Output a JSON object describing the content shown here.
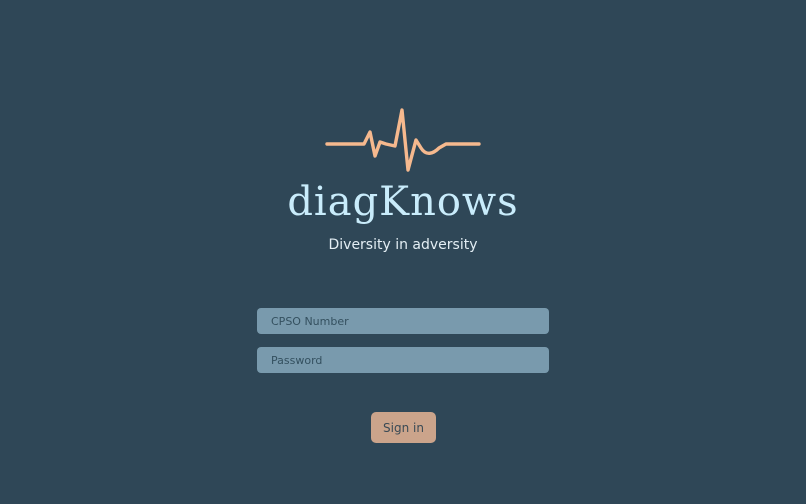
{
  "app": {
    "brand_name": "diagKnows",
    "tagline": "Diversity in adversity",
    "logo_icon": "heartbeat-pulse-icon",
    "accent_color": "#f6b98e",
    "background_color": "#2f4757"
  },
  "form": {
    "cpso_placeholder": "CPSO Number",
    "cpso_value": "",
    "password_placeholder": "Password",
    "password_value": "",
    "sign_in_label": "Sign in"
  }
}
